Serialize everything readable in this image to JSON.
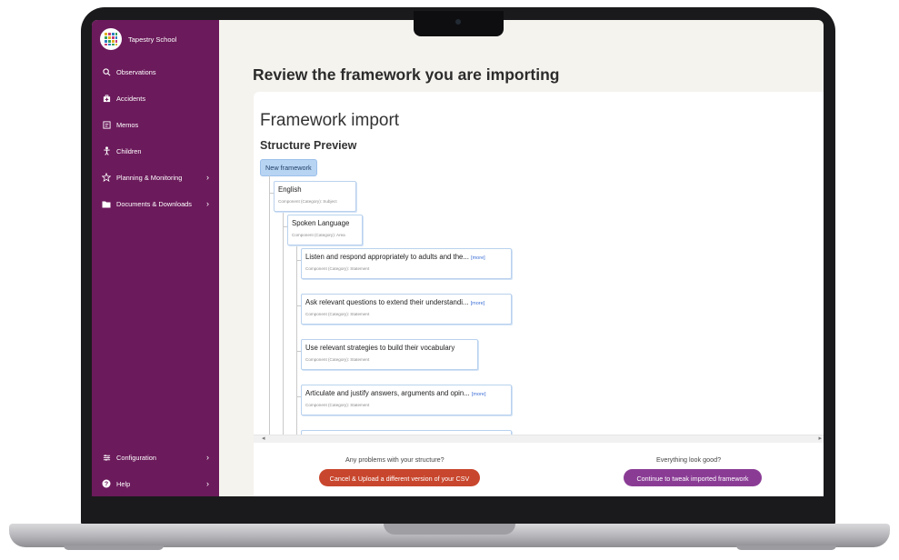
{
  "colors": {
    "sidebar": "#6b1a5b",
    "cancel_button": "#c8462d",
    "continue_button": "#8a3c95",
    "root_node": "#b8d4f3"
  },
  "sidebar": {
    "school_name": "Tapestry School",
    "items": [
      {
        "label": "Observations",
        "icon": "search-icon"
      },
      {
        "label": "Accidents",
        "icon": "first-aid-icon"
      },
      {
        "label": "Memos",
        "icon": "memo-icon"
      },
      {
        "label": "Children",
        "icon": "child-icon"
      },
      {
        "label": "Planning & Monitoring",
        "icon": "star-icon",
        "chevron": true
      },
      {
        "label": "Documents & Downloads",
        "icon": "folder-icon",
        "chevron": true
      }
    ],
    "bottom_items": [
      {
        "label": "Configuration",
        "icon": "settings-icon",
        "chevron": true
      },
      {
        "label": "Help",
        "icon": "help-icon",
        "chevron": true
      }
    ]
  },
  "main": {
    "page_title": "Review the framework you are importing",
    "card_title": "Framework import",
    "card_subtitle": "Structure Preview",
    "tree": {
      "root": "New framework",
      "nodes": [
        {
          "label": "English",
          "type": "Component (Category): Subject"
        },
        {
          "label": "Spoken Language",
          "type": "Component (Category): Area"
        },
        {
          "label": "Listen and respond appropriately to adults and the...",
          "more": "[more]",
          "type": "Component (Category): Statement"
        },
        {
          "label": "Ask relevant questions to extend their understandi...",
          "more": "[more]",
          "type": "Component (Category): Statement"
        },
        {
          "label": "Use relevant strategies to build their vocabulary",
          "type": "Component (Category): Statement"
        },
        {
          "label": "Articulate and justify answers, arguments and opin...",
          "more": "[more]",
          "type": "Component (Category): Statement"
        }
      ]
    },
    "footer": {
      "problems_question": "Any problems with your structure?",
      "cancel_button": "Cancel & Upload a different version of your CSV",
      "good_question": "Everything look good?",
      "continue_button": "Continue to tweak imported framework"
    }
  }
}
